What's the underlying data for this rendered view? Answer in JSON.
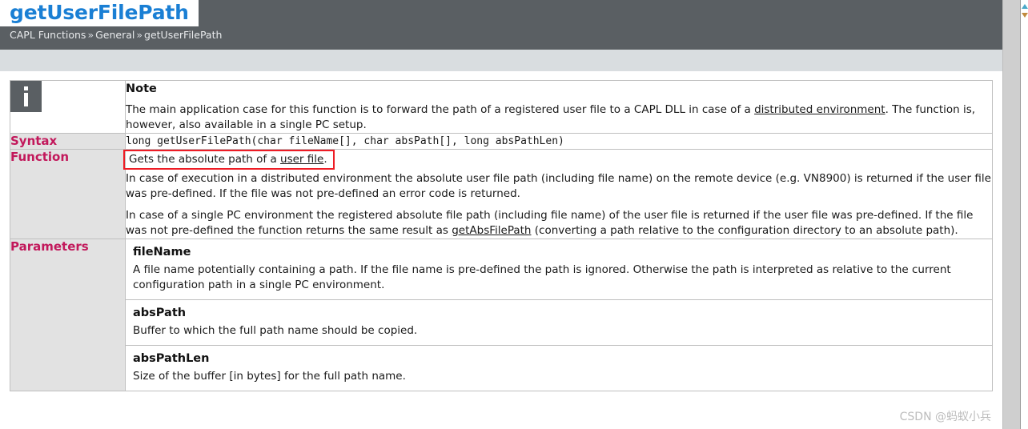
{
  "colors": {
    "header_bg": "#5a5f63",
    "title_blue": "#1a7fd4",
    "label_crimson": "#c2185b",
    "subbar_gray": "#d9dde0",
    "label_cell_gray": "#e2e2e2",
    "annotation_red": "#ee1c25",
    "border_gray": "#bfbfbf"
  },
  "header": {
    "title": "getUserFilePath",
    "breadcrumb": {
      "items": [
        "CAPL Functions",
        "General",
        "getUserFilePath"
      ],
      "separator": "»",
      "full": "CAPL Functions » General » getUserFilePath"
    }
  },
  "note": {
    "icon": "info-icon",
    "heading": "Note",
    "text_part1": "The main application case for this function is to forward the path of a registered user file to a CAPL DLL in case of a ",
    "link1": "distributed environment",
    "text_part2": ". The function is, however, also available in a single PC setup."
  },
  "syntax": {
    "label": "Syntax",
    "code": "long getUserFilePath(char fileName[], char absPath[], long absPathLen)"
  },
  "function": {
    "label": "Function",
    "highlight_part1": "Gets the absolute path of a ",
    "highlight_link": "user file",
    "highlight_part2": ".",
    "paragraph2": "In case of execution in a distributed environment the absolute user file path (including file name) on the remote device (e.g. VN8900) is returned if the user file was pre-defined. If the file was not pre-defined an error code is returned.",
    "paragraph3_part1": "In case of a single PC environment the registered absolute file path (including file name) of the user file is returned if the user file was pre-defined. If the file was not pre-defined the function returns the same result as ",
    "paragraph3_link": "getAbsFilePath",
    "paragraph3_part2": " (converting a path relative to the configuration directory to an absolute path)."
  },
  "parameters": {
    "label": "Parameters",
    "items": [
      {
        "name": "fileName",
        "description": "A file name potentially containing a path. If the file name is pre-defined the path is ignored. Otherwise the path is interpreted as relative to the current configuration path in a single PC environment."
      },
      {
        "name": "absPath",
        "description": "Buffer to which the full path name should be copied."
      },
      {
        "name": "absPathLen",
        "description": "Size of the buffer [in bytes] for the full path name."
      }
    ]
  },
  "watermark": {
    "text": "CSDN @蚂蚁小兵"
  }
}
